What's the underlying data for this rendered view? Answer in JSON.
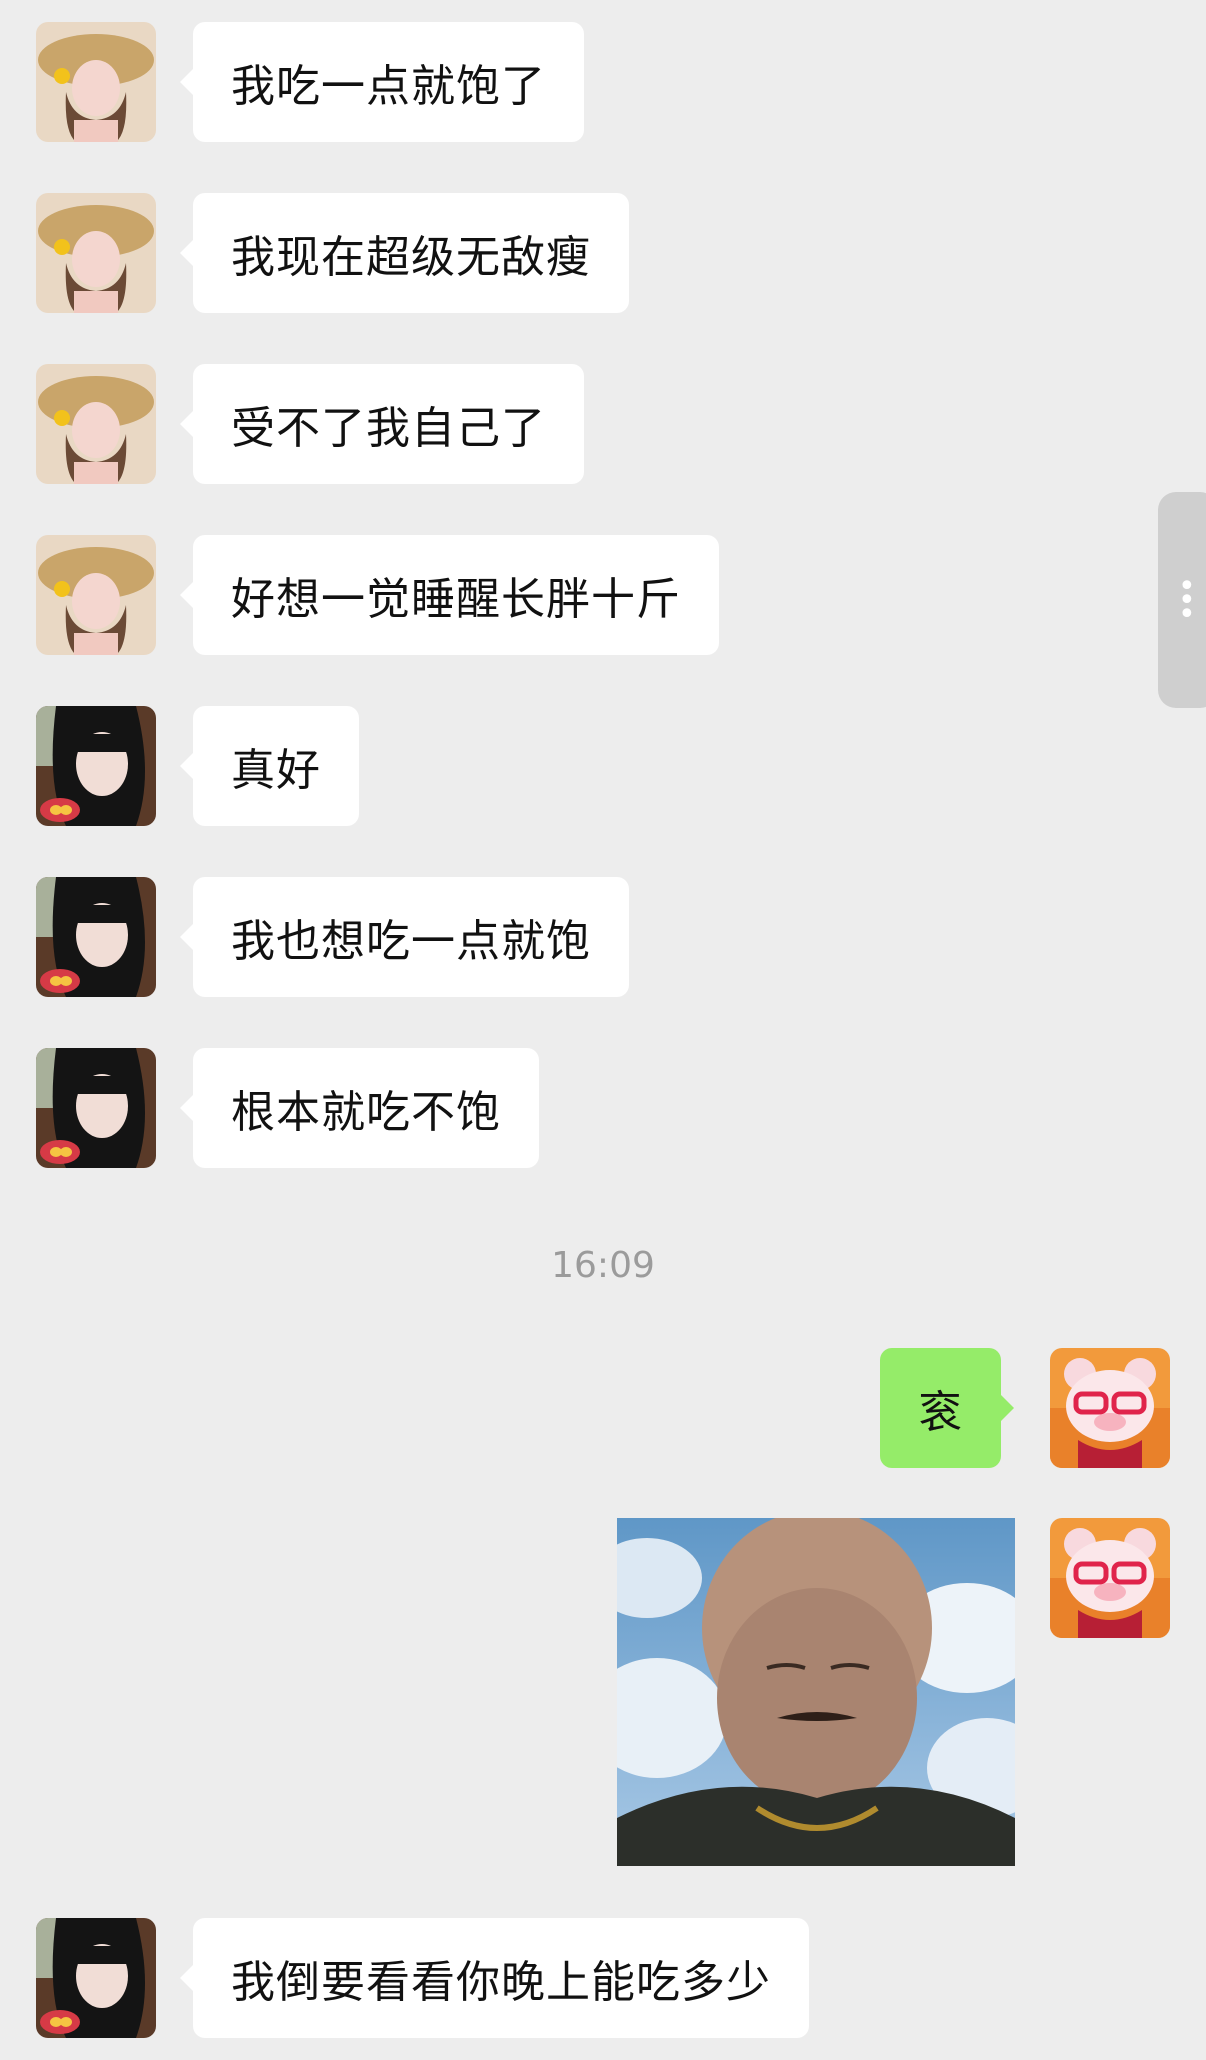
{
  "messages": [
    {
      "sender": "friend_a",
      "text": "我吃一点就饱了"
    },
    {
      "sender": "friend_a",
      "text": "我现在超级无敌瘦"
    },
    {
      "sender": "friend_a",
      "text": "受不了我自己了"
    },
    {
      "sender": "friend_a",
      "text": "好想一觉睡醒长胖十斤"
    },
    {
      "sender": "friend_b",
      "text": "真好"
    },
    {
      "sender": "friend_b",
      "text": "我也想吃一点就饱"
    },
    {
      "sender": "friend_b",
      "text": "根本就吃不饱"
    },
    {
      "sender": "me",
      "text": "衮"
    },
    {
      "sender": "me",
      "type": "sticker",
      "icon": "bald-man-sticker"
    },
    {
      "sender": "friend_b",
      "text": "我倒要看看你晚上能吃多少"
    }
  ],
  "timestamp": "16:09",
  "colors": {
    "background": "#ededed",
    "incoming_bubble": "#ffffff",
    "outgoing_bubble": "#95ec69",
    "timestamp_text": "#9b9b9b"
  }
}
